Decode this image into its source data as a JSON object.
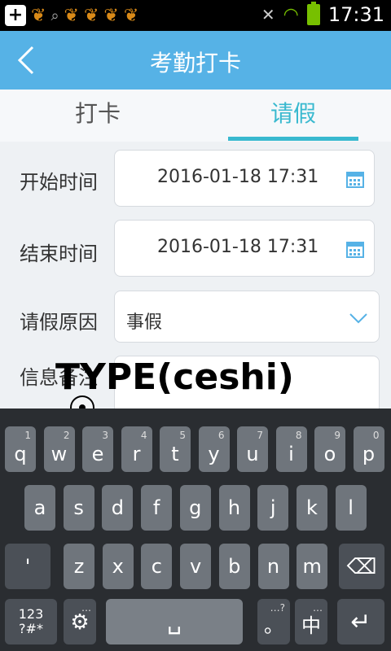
{
  "status_bar": {
    "time": "17:31",
    "icons": [
      "add-icon",
      "squirrel-icon",
      "search-icon",
      "squirrel-icon",
      "squirrel-icon",
      "squirrel-icon",
      "squirrel-icon",
      "mute-icon",
      "wifi-icon",
      "battery-icon"
    ]
  },
  "header": {
    "title": "考勤打卡",
    "back_icon": "chevron-left-icon"
  },
  "tabs": [
    {
      "label": "打卡"
    },
    {
      "label": "请假"
    }
  ],
  "form": {
    "start_label": "开始时间",
    "start_value": "2016-01-18 17:31",
    "end_label": "结束时间",
    "end_value": "2016-01-18 17:31",
    "reason_label": "请假原因",
    "reason_value": "事假",
    "info_label": "信息备注"
  },
  "overlay": {
    "type_text": "TYPE(ceshi)"
  },
  "keyboard": {
    "row1": [
      {
        "k": "q",
        "h": "1"
      },
      {
        "k": "w",
        "h": "2"
      },
      {
        "k": "e",
        "h": "3"
      },
      {
        "k": "r",
        "h": "4"
      },
      {
        "k": "t",
        "h": "5"
      },
      {
        "k": "y",
        "h": "6"
      },
      {
        "k": "u",
        "h": "7"
      },
      {
        "k": "i",
        "h": "8"
      },
      {
        "k": "o",
        "h": "9"
      },
      {
        "k": "p",
        "h": "0"
      }
    ],
    "row2": [
      "a",
      "s",
      "d",
      "f",
      "g",
      "h",
      "j",
      "k",
      "l"
    ],
    "row3": [
      "'",
      "z",
      "x",
      "c",
      "v",
      "b",
      "n",
      "m"
    ],
    "sym_key": "123\n?#*",
    "space": "␣",
    "period": "。",
    "period_hint": "…?",
    "zh": "中",
    "zh_hint": "…",
    "settings_hint": "…",
    "backspace": "⌫",
    "enter": "↵"
  }
}
